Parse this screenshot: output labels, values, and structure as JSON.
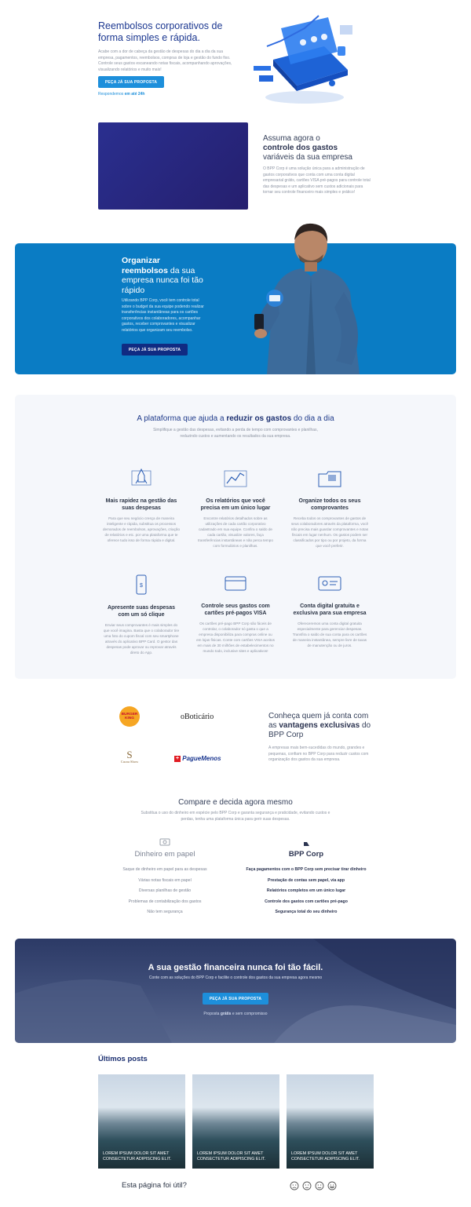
{
  "hero": {
    "title": "Reembolsos corporativos de forma simples e rápida.",
    "description": "Acabe com a dor de cabeça da gestão de despesas do dia a dia da sua empresa, pagamentos, reembolsos, compras de loja e gestão do fundo fixo. Controle seus gastos escaneando notas fiscais, acompanhando aprovações, visualizando relatórios e muito mais!",
    "cta_label": "PEÇA JÁ SUA PROPOSTA",
    "note_prefix": "Respondemos",
    "note_bold": "em até 24h"
  },
  "section_controle": {
    "title_line1": "Assuma agora o",
    "title_bold": "controle dos gastos",
    "title_line3": "variáveis da sua empresa",
    "description": "O BPP Corp é uma solução única para a administração de gastos corporativos que conta com uma conta digital empresarial grátis, cartões VISA pré-pagos para controle total das despesas e um aplicativo sem custos adicionais para tornar seu controle financeiro mais simples e prático!"
  },
  "banner": {
    "title_line1": "Organizar",
    "title_bold": "reembolsos",
    "title_rest": "da sua empresa nunca foi tão rápido",
    "description": "Utilizando BPP Corp, você tem controle total sobre o budget da sua equipe podendo realizar transferências instantâneas para os cartões corporativos dos colaboradores, acompanhar gastos, receber comprovantes e visualizar relatórios que organizam seu reembolso.",
    "cta_label": "PEÇA JÁ SUA PROPOSTA"
  },
  "platform": {
    "title_prefix": "A plataforma que ajuda a",
    "title_bold": "reduzir os gastos",
    "title_suffix": "do dia a dia",
    "subtitle": "Simplifique a gestão das despesas, evitando a perda de tempo com comprovantes e planilhas, reduzindo custos e aumentando os resultados da sua empresa.",
    "features": [
      {
        "title": "Mais rapidez na gestão das suas despesas",
        "description": "Para que seu negócio cresça de maneira inteligente e rápida, substitua os processos demorados de reembolsos, aprovações, criação de relatórios e etc. por uma plataforma que te oferece tudo isso de forma rápida e digital.",
        "icon": "rocket-icon"
      },
      {
        "title": "Os relatórios que você precisa em um único lugar",
        "description": "Encontre relatórios detalhados sobre as utilizações de cada cartão corporativo cadastrado em sua equipe. Confira o saldo de cada cartão, visualize valores, faça transferências instantâneas e não perca tempo com formulários e planilhas.",
        "icon": "chart-icon"
      },
      {
        "title": "Organize todos os seus comprovantes",
        "description": "Receba todos os comprovantes de gastos de seus colaboradores através da plataforma, você não precisa mais guardar comprovantes e notas fiscais em lugar nenhum. Os gastos podem ser classificados por tipo ou por projeto, da forma que você preferir.",
        "icon": "folder-icon"
      },
      {
        "title": "Apresente suas despesas com um só clique",
        "description": "Enviar seus comprovantes é mais simples do que você imagina. Basta que o colaborador tire uma foto do cupom fiscal com seu smartphone através do aplicativo BPP Card. O gestor das despesas pode aprovar ou reprovar através direto do App.",
        "icon": "phone-icon"
      },
      {
        "title": "Controle seus gastos com cartões pré-pagos VISA",
        "description": "Os cartões pré-pago BPP Corp são fáceis de controlar, o colaborador só gasta o que a empresa disponibiliza para compras online ou em lojas físicas. Conte com cartões VISA aceitos em mais de 30 milhões de estabelecimentos no mundo todo, inclusive sites e aplicativos!",
        "icon": "card-icon"
      },
      {
        "title": "Conta digital gratuita e exclusiva para sua empresa",
        "description": "Ofereceremos uma conta digital gratuita especialmente para gerenciar despesas. Transfira o saldo de sua conta para os cartões de maneira instantânea, sempre livre de taxas de manutenção ou de juros.",
        "icon": "id-card-icon"
      }
    ]
  },
  "clients": {
    "logos": [
      "BURGER KING",
      "oBoticário",
      "Cacau Show",
      "PagueMenos"
    ],
    "title_line1": "Conheça quem já conta com as",
    "title_bold": "vantagens exclusivas",
    "title_suffix": "do BPP Corp",
    "description": "A empresas mais bem-sucedidas do mundo, grandes e pequenas, confiam no BPP Corp para reduzir custos com organização dos gastos da sua empresa."
  },
  "compare": {
    "title": "Compare e decida agora mesmo",
    "subtitle": "Substitua o uso do dinheiro em espécie pelo BPP Corp e garanta segurança e praticidade, evitando custos e perdas, tenha uma plataforma única para gerir suas despesas.",
    "paper": {
      "title": "Dinheiro em papel",
      "items": [
        "Saque de dinheiro em papel para as despesas",
        "Várias notas fiscais em papel",
        "Diversas planilhas de gestão",
        "Problemas de contabilização dos gastos",
        "Não tem segurança"
      ]
    },
    "bpp": {
      "title": "BPP Corp",
      "items": [
        "Faça pagamentos com o BPP Corp sem precisar tirar dinheiro",
        "Prestação de contas sem papel, via app",
        "Relatórios completos em um único lugar",
        "Controle dos gastos com cartões pré-pago",
        "Segurança total do seu dinheiro"
      ]
    }
  },
  "final_cta": {
    "title": "A sua gestão financeira nunca foi tão fácil.",
    "subtitle": "Conte com as soluções do BPP Corp e facilite o controle dos gastos da sua empresa agora mesmo",
    "cta_label": "PEÇA JÁ SUA PROPOSTA",
    "note_prefix": "Proposta",
    "note_bold": "grátis",
    "note_suffix": "e sem compromisso"
  },
  "posts": {
    "title": "Últimos posts",
    "items": [
      {
        "title": "LOREM IPSUM DOLOR SIT AMET CONSECTETUR ADIPISCING ELIT."
      },
      {
        "title": "LOREM IPSUM DOLOR SIT AMET CONSECTETUR ADIPISCING ELIT."
      },
      {
        "title": "LOREM IPSUM DOLOR SIT AMET CONSECTETUR ADIPISCING ELIT."
      }
    ]
  },
  "feedback": {
    "label": "Esta página foi útil?",
    "icons": [
      "very-sad-face-icon",
      "neutral-face-icon",
      "smile-face-icon",
      "happy-face-icon"
    ]
  },
  "colors": {
    "primary_blue": "#1d8fdb",
    "navy": "#1b3790",
    "banner_blue": "#0a7cc4",
    "dark_button": "#102b82"
  }
}
